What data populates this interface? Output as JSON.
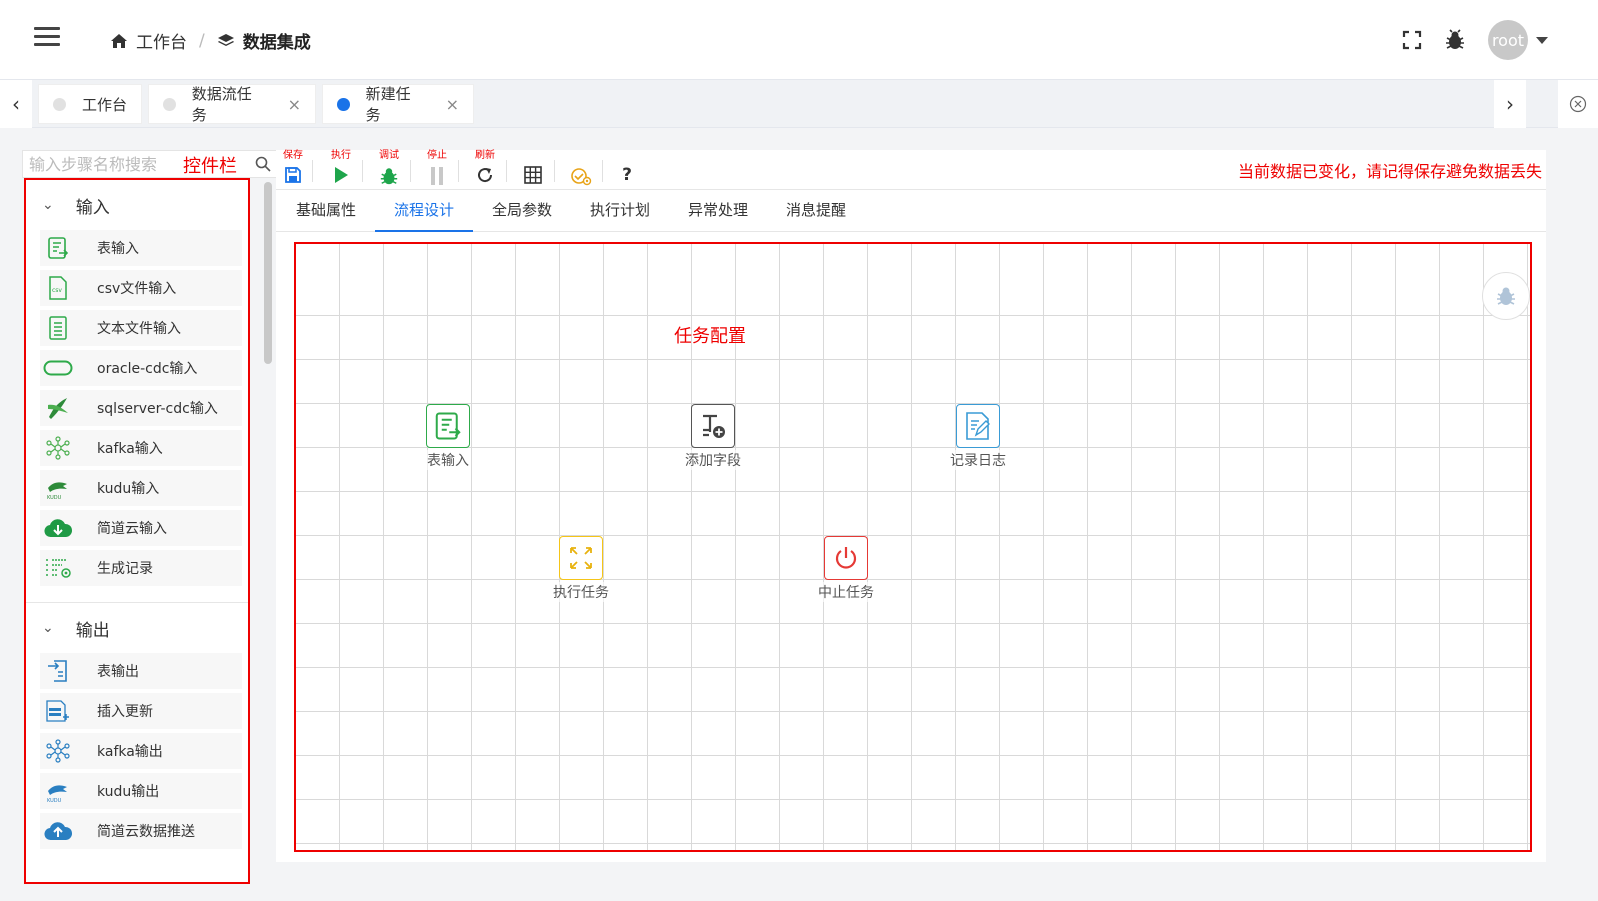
{
  "header": {
    "breadcrumb": [
      {
        "label": "工作台",
        "icon": "home-icon"
      },
      {
        "label": "数据集成",
        "icon": "layers-icon"
      }
    ],
    "user": "root"
  },
  "tabs": [
    {
      "label": "工作台",
      "closable": false,
      "active": false
    },
    {
      "label": "数据流任务",
      "closable": true,
      "active": false
    },
    {
      "label": "新建任务",
      "closable": true,
      "active": true
    }
  ],
  "tab_close_glyph": "×",
  "search": {
    "placeholder": "输入步骤名称搜索",
    "annotation": "控件栏"
  },
  "palette": {
    "groups": [
      {
        "title": "输入",
        "items": [
          {
            "label": "表输入",
            "icon": "table-input-icon"
          },
          {
            "label": "csv文件输入",
            "icon": "csv-file-icon"
          },
          {
            "label": "文本文件输入",
            "icon": "text-file-icon"
          },
          {
            "label": "oracle-cdc输入",
            "icon": "oracle-icon"
          },
          {
            "label": "sqlserver-cdc输入",
            "icon": "sqlserver-icon"
          },
          {
            "label": "kafka输入",
            "icon": "kafka-icon"
          },
          {
            "label": "kudu输入",
            "icon": "kudu-icon"
          },
          {
            "label": "简道云输入",
            "icon": "cloud-download-icon"
          },
          {
            "label": "生成记录",
            "icon": "generate-records-icon"
          }
        ]
      },
      {
        "title": "输出",
        "items": [
          {
            "label": "表输出",
            "icon": "table-output-icon"
          },
          {
            "label": "插入更新",
            "icon": "insert-update-icon"
          },
          {
            "label": "kafka输出",
            "icon": "kafka-icon"
          },
          {
            "label": "kudu输出",
            "icon": "kudu-icon"
          },
          {
            "label": "简道云数据推送",
            "icon": "cloud-upload-icon"
          }
        ]
      }
    ]
  },
  "toolbar": {
    "save": "保存",
    "run": "执行",
    "debug": "调试",
    "stop": "停止",
    "refresh": "刷新",
    "help": "?",
    "warning": "当前数据已变化，请记得保存避免数据丢失"
  },
  "design_tabs": [
    {
      "label": "基础属性",
      "active": false
    },
    {
      "label": "流程设计",
      "active": true
    },
    {
      "label": "全局参数",
      "active": false
    },
    {
      "label": "执行计划",
      "active": false
    },
    {
      "label": "异常处理",
      "active": false
    },
    {
      "label": "消息提醒",
      "active": false
    }
  ],
  "canvas": {
    "annotation": "任务配置",
    "nodes": [
      {
        "label": "表输入",
        "icon": "table-input-icon",
        "color": "#2eaa4a"
      },
      {
        "label": "添加字段",
        "icon": "add-field-icon",
        "color": "#555555"
      },
      {
        "label": "记录日志",
        "icon": "log-icon",
        "color": "#3a9bd5"
      },
      {
        "label": "执行任务",
        "icon": "execute-task-icon",
        "color": "#f5c518"
      },
      {
        "label": "中止任务",
        "icon": "power-icon",
        "color": "#e53935"
      }
    ]
  },
  "colors": {
    "accent": "#1a73e8",
    "annotation": "#e00000",
    "grid": "#d9d9d9"
  }
}
